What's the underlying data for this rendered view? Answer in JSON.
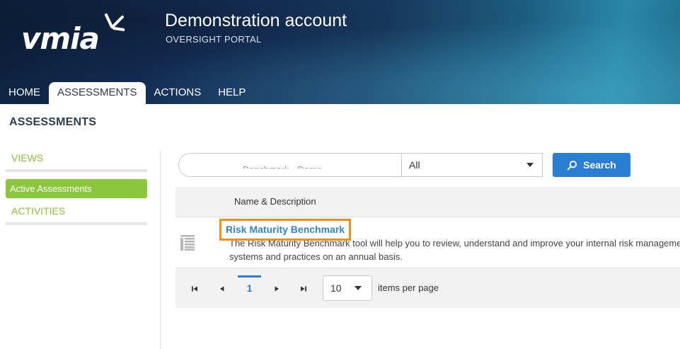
{
  "brand": {
    "logo_text": "vmia"
  },
  "account": {
    "title": "Demonstration account",
    "subtitle": "OVERSIGHT PORTAL"
  },
  "nav": {
    "items": [
      {
        "label": "HOME",
        "active": false
      },
      {
        "label": "ASSESSMENTS",
        "active": true
      },
      {
        "label": "ACTIONS",
        "active": false
      },
      {
        "label": "HELP",
        "active": false
      }
    ]
  },
  "page": {
    "title": "ASSESSMENTS"
  },
  "sidebar": {
    "views_heading": "VIEWS",
    "active_item": "Active Assessments",
    "activities_heading": "ACTIVITIES"
  },
  "search": {
    "input_value": "Benchmark - Demo",
    "filter_value": "All",
    "button_label": "Search"
  },
  "table": {
    "column_name": "Name & Description",
    "rows": [
      {
        "name": "Risk Maturity Benchmark",
        "description": "The Risk Maturity Benchmark tool will help you to review, understand and improve your internal risk management systems and practices on an annual basis."
      }
    ]
  },
  "pager": {
    "current_page": "1",
    "page_size": "10",
    "page_size_label": "items per page"
  },
  "colors": {
    "accent_green": "#8cc63f",
    "primary_blue": "#2b7cd3",
    "highlight_orange": "#f0901a",
    "link_blue": "#3386b8"
  }
}
